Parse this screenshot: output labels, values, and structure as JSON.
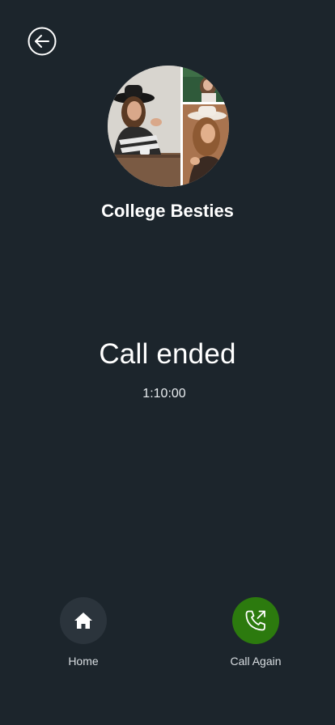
{
  "header": {
    "back_icon": "arrow-left-circle-icon"
  },
  "contact": {
    "name": "College Besties",
    "avatar_icon": "group-photo-collage"
  },
  "call": {
    "status": "Call ended",
    "duration": "1:10:00"
  },
  "actions": {
    "home": {
      "label": "Home",
      "icon": "home-icon"
    },
    "call_again": {
      "label": "Call Again",
      "icon": "phone-outgoing-icon",
      "color": "#2c7a0e"
    }
  },
  "colors": {
    "background": "#1c252c",
    "home_button": "#2b343c"
  }
}
